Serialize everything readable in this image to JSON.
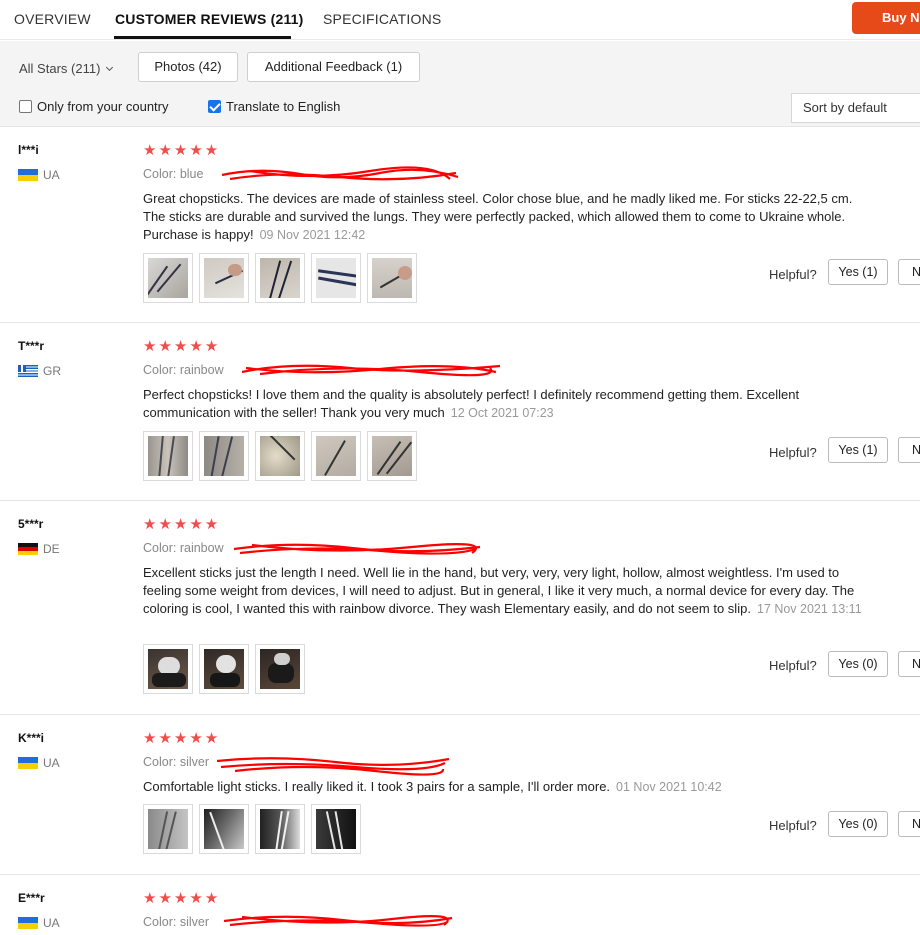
{
  "tabs": {
    "overview": "OVERVIEW",
    "reviews": "CUSTOMER REVIEWS (211)",
    "specifications": "SPECIFICATIONS",
    "buy_now": "Buy Now"
  },
  "filters": {
    "all_stars": "All Stars (211)",
    "photos": "Photos (42)",
    "additional": "Additional Feedback (1)",
    "only_country": "Only from your country",
    "only_country_checked": false,
    "translate": "Translate to English",
    "translate_checked": true,
    "sort": "Sort by default"
  },
  "labels": {
    "color_prefix": "Color:",
    "helpful": "Helpful?",
    "no": "No"
  },
  "colors": {
    "star": "#f04d4d",
    "buy_button": "#e64a19",
    "scribble": "#ff0000"
  },
  "reviews": [
    {
      "user": "l***i",
      "country": "UA",
      "rating": 5,
      "color": "blue",
      "text": "Great chopsticks. The devices are made of stainless steel. Color chose blue, and he madly liked me. For sticks 22-22,5 cm. The sticks are durable and survived the lungs. They were perfectly packed, which allowed them to come to Ukraine whole. Purchase is happy!",
      "date": "09 Nov 2021 12:42",
      "photos": 5,
      "yes": "Yes (1)"
    },
    {
      "user": "T***r",
      "country": "GR",
      "rating": 5,
      "color": "rainbow",
      "text": "Perfect chopsticks! I love them and the quality is absolutely perfect! I definitely recommend getting them. Excellent communication with the seller! Thank you very much",
      "date": "12 Oct 2021 07:23",
      "photos": 5,
      "yes": "Yes (1)"
    },
    {
      "user": "5***r",
      "country": "DE",
      "rating": 5,
      "color": "rainbow",
      "text": "Excellent sticks just the length I need. Well lie in the hand, but very, very, very light, hollow, almost weightless. I'm used to feeling some weight from devices, I will need to adjust. But in general, I like it very much, a normal device for every day. The coloring is cool, I wanted this with rainbow divorce. They wash Elementary easily, and do not seem to slip.",
      "date": "17 Nov 2021 13:11",
      "photos": 3,
      "yes": "Yes (0)"
    },
    {
      "user": "K***i",
      "country": "UA",
      "rating": 5,
      "color": "silver",
      "text": "Comfortable light sticks. I really liked it. I took 3 pairs for a sample, I'll order more.",
      "date": "01 Nov 2021 10:42",
      "photos": 4,
      "yes": "Yes (0)"
    },
    {
      "user": "E***r",
      "country": "UA",
      "rating": 5,
      "color": "silver"
    }
  ]
}
